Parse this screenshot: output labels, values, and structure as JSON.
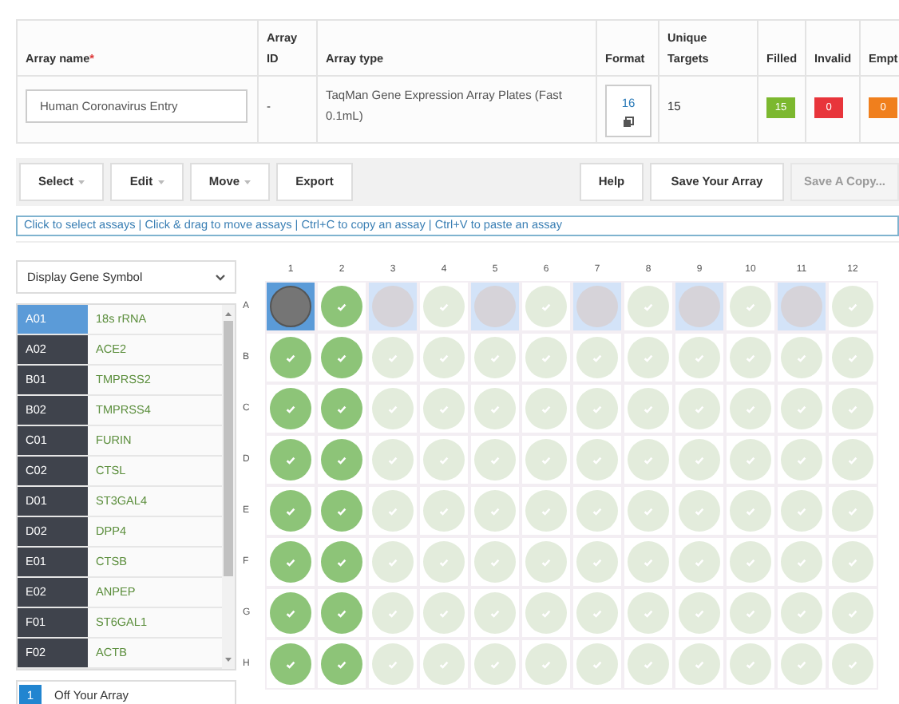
{
  "summary_table": {
    "columns": [
      {
        "label": "Array name",
        "required_mark": "*"
      },
      {
        "label": "Array ID"
      },
      {
        "label": "Array type"
      },
      {
        "label": "Format"
      },
      {
        "label": "Unique Targets"
      },
      {
        "label": "Filled"
      },
      {
        "label": "Invalid"
      },
      {
        "label": "Empt"
      }
    ],
    "array_name": "Human Coronavirus Entry",
    "array_id": "-",
    "array_type": "TaqMan Gene Expression Array Plates (Fast 0.1mL)",
    "format": "16",
    "unique_targets": "15",
    "counts": [
      {
        "value": "15",
        "color": "#7cb82f"
      },
      {
        "value": "0",
        "color": "#e8353b"
      },
      {
        "value": "0",
        "color": "#f07f1d"
      }
    ]
  },
  "toolbar": {
    "left": [
      {
        "label": "Select",
        "dropdown": true
      },
      {
        "label": "Edit",
        "dropdown": true
      },
      {
        "label": "Move",
        "dropdown": true
      },
      {
        "label": "Export",
        "dropdown": false
      }
    ],
    "right": [
      {
        "label": "Help",
        "disabled": false
      },
      {
        "label": "Save Your Array",
        "disabled": false
      },
      {
        "label": "Save A Copy...",
        "disabled": true
      }
    ]
  },
  "hint": "Click to select assays | Click & drag to move assays | Ctrl+C to copy an assay | Ctrl+V to paste an assay",
  "display_select": "Display Gene Symbol",
  "assays": [
    {
      "well": "A01",
      "gene": "18s rRNA",
      "selected": true
    },
    {
      "well": "A02",
      "gene": "ACE2",
      "selected": false
    },
    {
      "well": "B01",
      "gene": "TMPRSS2",
      "selected": false
    },
    {
      "well": "B02",
      "gene": "TMPRSS4",
      "selected": false
    },
    {
      "well": "C01",
      "gene": "FURIN",
      "selected": false
    },
    {
      "well": "C02",
      "gene": "CTSL",
      "selected": false
    },
    {
      "well": "D01",
      "gene": "ST3GAL4",
      "selected": false
    },
    {
      "well": "D02",
      "gene": "DPP4",
      "selected": false
    },
    {
      "well": "E01",
      "gene": "CTSB",
      "selected": false
    },
    {
      "well": "E02",
      "gene": "ANPEP",
      "selected": false
    },
    {
      "well": "F01",
      "gene": "ST6GAL1",
      "selected": false
    },
    {
      "well": "F02",
      "gene": "ACTB",
      "selected": false
    }
  ],
  "off_array": {
    "count": "1",
    "label": "Off Your Array"
  },
  "plate": {
    "columns": [
      "1",
      "2",
      "3",
      "4",
      "5",
      "6",
      "7",
      "8",
      "9",
      "10",
      "11",
      "12"
    ],
    "rows": [
      {
        "label": "A",
        "wells": [
          {
            "kind": "selected"
          },
          {
            "kind": "filled"
          },
          {
            "kind": "highlighted"
          },
          {
            "kind": "empty"
          },
          {
            "kind": "highlighted"
          },
          {
            "kind": "empty"
          },
          {
            "kind": "highlighted"
          },
          {
            "kind": "empty"
          },
          {
            "kind": "highlighted"
          },
          {
            "kind": "empty"
          },
          {
            "kind": "highlighted"
          },
          {
            "kind": "empty"
          }
        ]
      },
      {
        "label": "B",
        "wells": [
          {
            "kind": "filled"
          },
          {
            "kind": "filled"
          },
          {
            "kind": "empty"
          },
          {
            "kind": "empty"
          },
          {
            "kind": "empty"
          },
          {
            "kind": "empty"
          },
          {
            "kind": "empty"
          },
          {
            "kind": "empty"
          },
          {
            "kind": "empty"
          },
          {
            "kind": "empty"
          },
          {
            "kind": "empty"
          },
          {
            "kind": "empty"
          }
        ]
      },
      {
        "label": "C",
        "wells": [
          {
            "kind": "filled"
          },
          {
            "kind": "filled"
          },
          {
            "kind": "empty"
          },
          {
            "kind": "empty"
          },
          {
            "kind": "empty"
          },
          {
            "kind": "empty"
          },
          {
            "kind": "empty"
          },
          {
            "kind": "empty"
          },
          {
            "kind": "empty"
          },
          {
            "kind": "empty"
          },
          {
            "kind": "empty"
          },
          {
            "kind": "empty"
          }
        ]
      },
      {
        "label": "D",
        "wells": [
          {
            "kind": "filled"
          },
          {
            "kind": "filled"
          },
          {
            "kind": "empty"
          },
          {
            "kind": "empty"
          },
          {
            "kind": "empty"
          },
          {
            "kind": "empty"
          },
          {
            "kind": "empty"
          },
          {
            "kind": "empty"
          },
          {
            "kind": "empty"
          },
          {
            "kind": "empty"
          },
          {
            "kind": "empty"
          },
          {
            "kind": "empty"
          }
        ]
      },
      {
        "label": "E",
        "wells": [
          {
            "kind": "filled"
          },
          {
            "kind": "filled"
          },
          {
            "kind": "empty"
          },
          {
            "kind": "empty"
          },
          {
            "kind": "empty"
          },
          {
            "kind": "empty"
          },
          {
            "kind": "empty"
          },
          {
            "kind": "empty"
          },
          {
            "kind": "empty"
          },
          {
            "kind": "empty"
          },
          {
            "kind": "empty"
          },
          {
            "kind": "empty"
          }
        ]
      },
      {
        "label": "F",
        "wells": [
          {
            "kind": "filled"
          },
          {
            "kind": "filled"
          },
          {
            "kind": "empty"
          },
          {
            "kind": "empty"
          },
          {
            "kind": "empty"
          },
          {
            "kind": "empty"
          },
          {
            "kind": "empty"
          },
          {
            "kind": "empty"
          },
          {
            "kind": "empty"
          },
          {
            "kind": "empty"
          },
          {
            "kind": "empty"
          },
          {
            "kind": "empty"
          }
        ]
      },
      {
        "label": "G",
        "wells": [
          {
            "kind": "filled"
          },
          {
            "kind": "filled"
          },
          {
            "kind": "empty"
          },
          {
            "kind": "empty"
          },
          {
            "kind": "empty"
          },
          {
            "kind": "empty"
          },
          {
            "kind": "empty"
          },
          {
            "kind": "empty"
          },
          {
            "kind": "empty"
          },
          {
            "kind": "empty"
          },
          {
            "kind": "empty"
          },
          {
            "kind": "empty"
          }
        ]
      },
      {
        "label": "H",
        "wells": [
          {
            "kind": "filled"
          },
          {
            "kind": "filled"
          },
          {
            "kind": "empty"
          },
          {
            "kind": "empty"
          },
          {
            "kind": "empty"
          },
          {
            "kind": "empty"
          },
          {
            "kind": "empty"
          },
          {
            "kind": "empty"
          },
          {
            "kind": "empty"
          },
          {
            "kind": "empty"
          },
          {
            "kind": "empty"
          },
          {
            "kind": "empty"
          }
        ]
      }
    ]
  }
}
